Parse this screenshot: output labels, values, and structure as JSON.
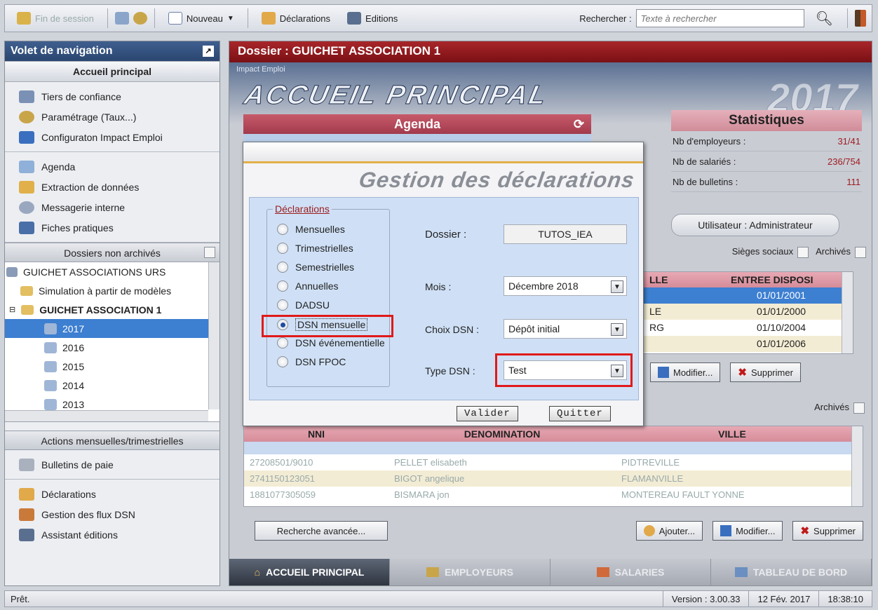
{
  "toolbar": {
    "end_session": "Fin de session",
    "new_label": "Nouveau",
    "declarations_label": "Déclarations",
    "editions_label": "Editions",
    "search_label": "Rechercher :",
    "search_placeholder": "Texte à rechercher"
  },
  "nav": {
    "title": "Volet de navigation",
    "home_section": "Accueil principal",
    "group1": [
      "Tiers de confiance",
      "Paramétrage (Taux...)",
      "Configuraton Impact Emploi"
    ],
    "group2": [
      "Agenda",
      "Extraction de données",
      "Messagerie interne",
      "Fiches pratiques"
    ],
    "folders_header": "Dossiers non archivés",
    "tree": {
      "root": "GUICHET ASSOCIATIONS URS",
      "simulation": "Simulation à partir de modèles",
      "folder": "GUICHET ASSOCIATION 1",
      "years": [
        "2017",
        "2016",
        "2015",
        "2014",
        "2013"
      ],
      "selected_year": "2017"
    },
    "actions_header": "Actions mensuelles/trimestrielles",
    "group3": [
      "Bulletins de paie"
    ],
    "group4": [
      "Déclarations",
      "Gestion des flux DSN",
      "Assistant éditions"
    ]
  },
  "main": {
    "dossier_title": "Dossier : GUICHET ASSOCIATION 1",
    "hero_sub": "Impact Emploi",
    "hero_title": "ACCUEIL PRINCIPAL",
    "hero_year": "2017",
    "agenda_title": "Agenda",
    "stats": {
      "title": "Statistiques",
      "rows": [
        {
          "label": "Nb d'employeurs :",
          "value": "31/41"
        },
        {
          "label": "Nb de salariés :",
          "value": "236/754"
        },
        {
          "label": "Nb de bulletins :",
          "value": "111"
        }
      ]
    },
    "user_button": "Utilisateur : Administrateur",
    "sieges_label": "Sièges sociaux",
    "archives_label": "Archivés",
    "employer_grid": {
      "col_ville": "LLE",
      "col_entree": "ENTREE DISPOSI",
      "rows": [
        {
          "ville": "",
          "date": "01/01/2001"
        },
        {
          "ville": "LE",
          "date": "01/01/2000"
        },
        {
          "ville": "RG",
          "date": "01/10/2004"
        },
        {
          "ville": "",
          "date": "01/01/2006"
        }
      ]
    },
    "modify_label": "Modifier...",
    "delete_label": "Supprimer",
    "add_label": "Ajouter...",
    "archives_label2": "Archivés",
    "employee_grid": {
      "col_nni": "NNI",
      "col_denomination": "DENOMINATION",
      "col_ville": "VILLE",
      "rows": [
        {
          "nni": "27208501/9010",
          "name": "PELLET elisabeth",
          "ville": "PIDTREVILLE"
        },
        {
          "nni": "2741150123051",
          "name": "BIGOT angelique",
          "ville": "FLAMANVILLE"
        },
        {
          "nni": "1881077305059",
          "name": "BISMARA jon",
          "ville": "MONTEREAU FAULT YONNE"
        }
      ]
    },
    "advanced_search": "Recherche avancée...",
    "tabs": [
      "ACCUEIL PRINCIPAL",
      "EMPLOYEURS",
      "SALARIES",
      "TABLEAU DE BORD"
    ]
  },
  "dialog": {
    "banner": "Gestion des déclarations",
    "group_legend": "Déclarations",
    "options": [
      "Mensuelles",
      "Trimestrielles",
      "Semestrielles",
      "Annuelles",
      "DADSU",
      "DSN mensuelle",
      "DSN événementielle",
      "DSN FPOC"
    ],
    "selected_option": "DSN mensuelle",
    "dossier_label": "Dossier :",
    "dossier_value": "TUTOS_IEA",
    "mois_label": "Mois :",
    "mois_value": "Décembre 2018",
    "choix_label": "Choix DSN :",
    "choix_value": "Dépôt initial",
    "type_label": "Type DSN :",
    "type_value": "Test",
    "validate_button": "Valider",
    "quit_button": "Quitter"
  },
  "status": {
    "ready": "Prêt.",
    "version": "Version : 3.00.33",
    "date": "12 Fév. 2017",
    "time": "18:38:10"
  },
  "colors": {
    "accent_red": "#a8262a",
    "nav_blue": "#2a4670",
    "highlight": "#e01a1a"
  }
}
